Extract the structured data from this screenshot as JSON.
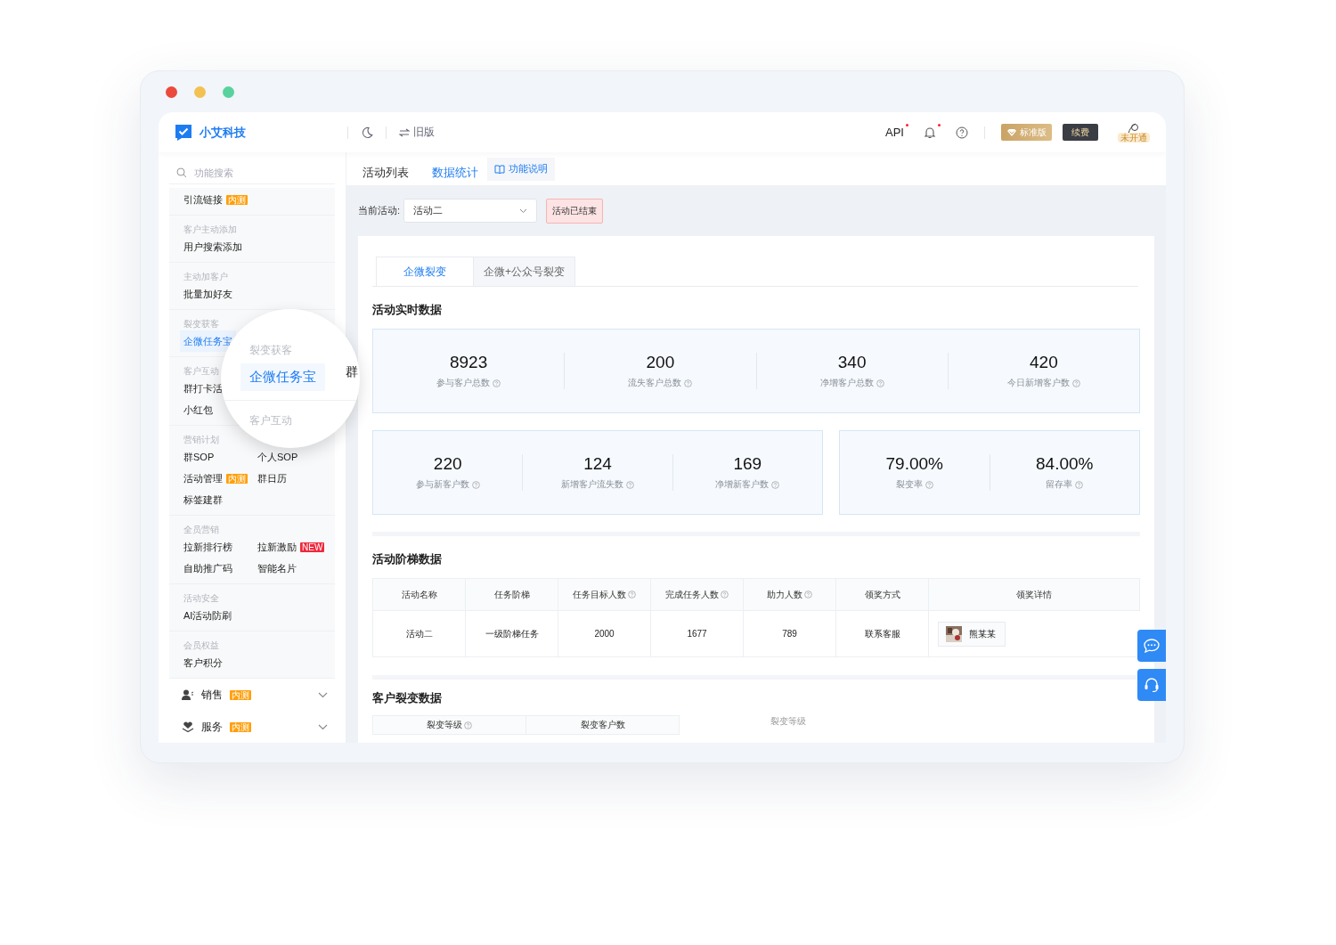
{
  "header": {
    "brand": "小艾科技",
    "old_version": "旧版",
    "api": {
      "label": "API",
      "dot": true
    },
    "bell": {
      "dot": true
    },
    "plan": "标准版",
    "renew": "续费",
    "account_tag": "未开通"
  },
  "sidebar": {
    "search_placeholder": "功能搜索",
    "groups": [
      {
        "kind": "list",
        "items": [
          {
            "label": "引流链接",
            "selected": false,
            "badge": {
              "kind": "beta",
              "text": "内测"
            }
          }
        ]
      },
      {
        "kind": "list",
        "title": "客户主动添加",
        "items": [
          {
            "label": "用户搜索添加",
            "selected": false
          }
        ]
      },
      {
        "kind": "list",
        "title": "主动加客户",
        "items": [
          {
            "label": "批量加好友",
            "selected": false
          }
        ]
      },
      {
        "kind": "list",
        "title": "裂变获客",
        "items": [
          {
            "label": "企微任务宝",
            "selected": true
          }
        ]
      },
      {
        "kind": "list",
        "title": "客户互动",
        "items": [
          {
            "label": "群打卡活",
            "selected": false
          },
          {
            "label": "小红包",
            "selected": false
          }
        ]
      },
      {
        "kind": "grid",
        "title": "营销计划",
        "items": [
          {
            "label": "群SOP",
            "selected": false
          },
          {
            "label": "个人SOP",
            "selected": false
          },
          {
            "label": "活动管理",
            "selected": false,
            "badge": {
              "kind": "beta",
              "text": "内测"
            }
          },
          {
            "label": "群日历",
            "selected": false
          },
          {
            "label": "标签建群",
            "selected": false
          }
        ]
      },
      {
        "kind": "grid",
        "title": "全员营销",
        "items": [
          {
            "label": "拉新排行榜",
            "selected": false
          },
          {
            "label": "拉新激励",
            "selected": false,
            "badge": {
              "kind": "new",
              "text": "NEW"
            }
          },
          {
            "label": "自助推广码",
            "selected": false
          },
          {
            "label": "智能名片",
            "selected": false
          }
        ]
      },
      {
        "kind": "list",
        "title": "活动安全",
        "items": [
          {
            "label": "AI活动防刷",
            "selected": false
          }
        ]
      },
      {
        "kind": "list",
        "title": "会员权益",
        "items": [
          {
            "label": "客户积分",
            "selected": false
          }
        ]
      }
    ],
    "sections": [
      {
        "kind": "sales",
        "label": "销售",
        "badge": "内测",
        "expanded": false
      },
      {
        "kind": "service",
        "label": "服务",
        "badge": "内测",
        "expanded": false
      }
    ]
  },
  "magnifier": {
    "title": "裂变获客",
    "item": {
      "label": "企微任务宝",
      "selected": true
    },
    "next_title": "客户互动",
    "side_text": "群"
  },
  "tabs": [
    {
      "label": "活动列表",
      "selected": false
    },
    {
      "label": "数据统计",
      "selected": true
    }
  ],
  "help_button": "功能说明",
  "filter": {
    "label": "当前活动:",
    "value": "活动二",
    "status": "活动已结束"
  },
  "sub_tabs": [
    {
      "label": "企微裂变",
      "selected": true
    },
    {
      "label": "企微+公众号裂变",
      "selected": false
    }
  ],
  "realtime": {
    "title": "活动实时数据",
    "rows": [
      [
        [
          {
            "value": "8923",
            "label": "参与客户总数"
          },
          {
            "value": "200",
            "label": "流失客户总数"
          },
          {
            "value": "340",
            "label": "净增客户总数"
          },
          {
            "value": "420",
            "label": "今日新增客户数"
          }
        ]
      ],
      [
        [
          {
            "value": "220",
            "label": "参与新客户数"
          },
          {
            "value": "124",
            "label": "新增客户流失数"
          },
          {
            "value": "169",
            "label": "净增新客户数"
          }
        ],
        [
          {
            "value": "79.00%",
            "label": "裂变率"
          },
          {
            "value": "84.00%",
            "label": "留存率"
          }
        ]
      ]
    ]
  },
  "ladder": {
    "title": "活动阶梯数据",
    "columns": [
      {
        "label": "活动名称",
        "help": false
      },
      {
        "label": "任务阶梯",
        "help": false
      },
      {
        "label": "任务目标人数",
        "help": true
      },
      {
        "label": "完成任务人数",
        "help": true
      },
      {
        "label": "助力人数",
        "help": true
      },
      {
        "label": "领奖方式",
        "help": false
      },
      {
        "label": "领奖详情",
        "help": false
      }
    ],
    "rows": [
      {
        "cells": [
          "活动二",
          "一级阶梯任务",
          "2000",
          "1677",
          "789",
          "联系客服"
        ],
        "winner": "熊某某"
      }
    ]
  },
  "fission": {
    "title": "客户裂变数据",
    "columns": [
      {
        "label": "裂变等级",
        "help": true
      },
      {
        "label": "裂变客户数",
        "help": false
      }
    ],
    "chart_label": "裂变等级"
  }
}
